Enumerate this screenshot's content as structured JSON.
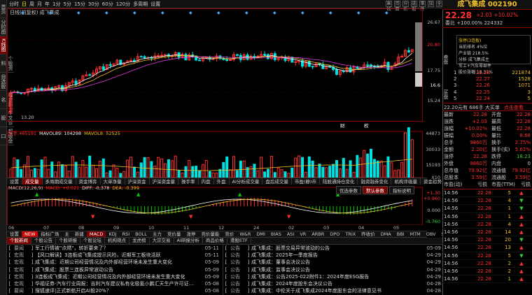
{
  "sidebar": {
    "items": [
      "首页",
      "分时图",
      "K线图",
      "个股资料",
      "自选股",
      "综合排名",
      "牛叉诊股",
      "超级盘口"
    ]
  },
  "toolbar": {
    "items": [
      "分时",
      "日",
      "周",
      "月",
      "年",
      "1分",
      "5分",
      "15分",
      "30分",
      "60分",
      "120分",
      "多周期",
      "设置"
    ],
    "selected": "日"
  },
  "toolbar_right": [
    "画线",
    "页面",
    "分析",
    "选股",
    "事件",
    "加",
    "全"
  ],
  "chart": {
    "title": "日线(前复权) 成飞集成",
    "price_axis": [
      "26.67",
      "20.80",
      "17.75",
      "16.6",
      "15.24"
    ],
    "low_label": "13.20",
    "high_box": "20.80",
    "last_box": "16.8",
    "ma_header": [
      {
        "t": "总手:465191",
        "c": "#ff3030"
      },
      {
        "t": "MAVOL89: 104298",
        "c": "#f0f0f0"
      },
      {
        "t": "MAVOL8: 52525",
        "c": "#f0c020"
      }
    ],
    "vol_axis": [
      "44873",
      "30033",
      "15193",
      "X10"
    ],
    "macd_header": [
      {
        "t": "MACD(12,26,9)",
        "c": "#ccc"
      },
      {
        "t": "MACD: +0.021",
        "c": "#ff3030"
      },
      {
        "t": "DIFF: -0.378",
        "c": "#f0f0f0"
      },
      {
        "t": "DEA: -0.399",
        "c": "#f0c020"
      }
    ],
    "macd_axis": [
      "+1.30",
      "+0.960",
      "0.000",
      "-0.760"
    ],
    "dates": [
      "06",
      "07",
      "08",
      "09",
      "10",
      "11",
      "12",
      "24",
      "02",
      "03",
      "04",
      "05"
    ],
    "event_tags": [
      "财",
      "权"
    ]
  },
  "tabs_mid": [
    "设置",
    "成交量",
    "多周期成交量",
    "资金博弈",
    "大单净量",
    "沪深资金",
    "沪深资金量",
    "操手率",
    "内盘",
    "外盘",
    "AI分析成交量",
    "盘后成交量",
    "市盈(静)市",
    "陆股通持仓变化",
    "融资融券变化",
    "机构评级量",
    "资金趋势"
  ],
  "tabs_mid_selected": "成交量",
  "macd_buttons": [
    "优选参数",
    "默认参数",
    "指标说明"
  ],
  "indicator_tabs": [
    "设置",
    "NEW",
    "指标广场",
    "主",
    "新建",
    "MACD",
    "KDJ",
    "RSI",
    "BOLL",
    "主力",
    "竞价量",
    "涨停",
    "竞价量能",
    "竞价",
    "W&R",
    "DMI",
    "BIAS",
    "ASI",
    "VR",
    "ARBR",
    "DPO",
    "TRIX",
    "昨收价",
    "DMA",
    "BBI",
    "MTM",
    "OBV",
    "SAR",
    "EXPMA"
  ],
  "indicator_selected": "MACD",
  "news_tabs": [
    "个股新闻",
    "个股公告",
    "个股研报",
    "个股论坛",
    "机构观点",
    "龙虎榜",
    "大宗交易",
    "AI研报分析",
    "商品价格",
    "港股ETF"
  ],
  "news_selected": "个股新闻",
  "news_left": [
    {
      "tag": "要闻",
      "title": "军工行情被\"点燃\"，转折要来了？",
      "date": "05-11"
    },
    {
      "tag": "宏观",
      "title": "【风口解读】3连板成飞集成提示风险，近期军工板块活跃",
      "date": "05-11"
    },
    {
      "tag": "宏观",
      "title": "成飞集成：近期公司经营情况及内外部经营环境未发生重大变化",
      "date": "05-09"
    },
    {
      "tag": "宏观",
      "title": "成飞集成：股票三连板异常波动公告",
      "date": "05-09"
    },
    {
      "tag": "宏观",
      "title": "3连板成飞集成：近期公司经营情况及内外部经营环境未发生重大变化",
      "date": "05-09"
    },
    {
      "tag": "宏观",
      "title": "华福证券-汽车行业周报：吉利汽车建议私有化极氪小鹏汇天生产许可证…",
      "date": "05-08"
    },
    {
      "tag": "要闻",
      "title": "搜狐速评|正式新航开启AI股20%？",
      "date": "05-08"
    }
  ],
  "news_right": [
    {
      "tag": "公告",
      "title": "成飞集成：股票交易异常波动的公告",
      "date": "05-09"
    },
    {
      "tag": "公告",
      "title": "成飞集成：2025年一季度报告",
      "date": "04-29"
    },
    {
      "tag": "公告",
      "title": "成飞集成：董事会决议公告",
      "date": "04-29"
    },
    {
      "tag": "公告",
      "title": "成飞集成：监事会决议公告",
      "date": "04-29"
    },
    {
      "tag": "公告",
      "title": "成飞集成：公告2025-022附件1：2024年度ESG报告",
      "date": "04-29"
    },
    {
      "tag": "公告",
      "title": "成飞集成：2024年度股东会决议公告",
      "date": "04-28"
    },
    {
      "tag": "公告",
      "title": "成飞集成：中伦关于成飞集成2024年度股东会的法律意见书",
      "date": "04-28"
    }
  ],
  "quote": {
    "title": "成飞集成 002190",
    "price": "22.28",
    "change": "+2.03 +10.02%",
    "weibi": "委比 +100.00% 224332",
    "bubble": [
      "涨停(3连板)",
      "当前排名 4%位",
      "产业链 218.5%",
      "分析 成飞集成主",
      "军工+汽车零部件",
      "股价涨幅 18.31%"
    ],
    "sell": [
      {
        "k": "5",
        "p": "",
        "v": ""
      },
      {
        "k": "4",
        "p": "",
        "v": ""
      },
      {
        "k": "3",
        "p": "",
        "v": ""
      },
      {
        "k": "2",
        "p": "",
        "v": ""
      },
      {
        "k": "1",
        "p": "",
        "v": ""
      }
    ],
    "buy": [
      {
        "k": "1",
        "p": "22.28",
        "v": "221874"
      },
      {
        "k": "2",
        "p": "22.27",
        "v": "1528"
      },
      {
        "k": "3",
        "p": "22.26",
        "v": "1071"
      },
      {
        "k": "4",
        "p": "22.25",
        "v": "3"
      },
      {
        "k": "5",
        "p": "22.24",
        "v": "5"
      }
    ],
    "buy_label": "买盘",
    "sell_label": "卖盘",
    "big_order": "22.20元有 686手 大买单",
    "view_btn": "点击查看",
    "stats": [
      [
        "最新",
        "22.28",
        "开盘",
        "22.28"
      ],
      [
        "涨跌",
        "+2.03",
        "最高",
        "22.28"
      ],
      [
        "涨幅",
        "+10.02%",
        "最低",
        "22.28"
      ],
      [
        "振幅",
        "0.00%",
        "量比",
        "8.68"
      ],
      [
        "总手",
        "9860万",
        "换手",
        "2.75%"
      ],
      [
        "金额",
        "2.20亿",
        "换手(实)",
        "5.62%"
      ],
      [
        "涨停",
        "22.28",
        "跌停",
        "18.23"
      ],
      [
        "外盘",
        "9860万",
        "内盘",
        "0"
      ],
      [
        "总市值",
        "79.92亿",
        "流通值",
        "79.92亿"
      ],
      [
        "总股本",
        "3.59亿",
        "流通股",
        "3.59亿"
      ],
      [
        "市盈(动)",
        "亏损",
        "市盈(TTM)",
        "亏损"
      ]
    ],
    "ticks": [
      {
        "t": "14:56",
        "p": "22.28",
        "v": "5",
        "d": "up"
      },
      {
        "t": "14:56",
        "p": "22.28",
        "v": "4",
        "d": "dn"
      },
      {
        "t": "14:56",
        "p": "22.28",
        "v": "1",
        "d": "dn"
      },
      {
        "t": "14:56",
        "p": "22.28",
        "v": "1",
        "d": "up"
      },
      {
        "t": "14:56",
        "p": "22.28",
        "v": "4",
        "d": "up"
      },
      {
        "t": "14:56",
        "p": "22.28",
        "v": "14",
        "d": "up"
      },
      {
        "t": "14:56",
        "p": "22.28",
        "v": "20",
        "d": "dn"
      },
      {
        "t": "14:56",
        "p": "22.28",
        "v": "13",
        "d": "up"
      },
      {
        "t": "14:56",
        "p": "22.28",
        "v": "5",
        "d": "dn"
      },
      {
        "t": "14:56",
        "p": "22.28",
        "v": "2",
        "d": "up"
      },
      {
        "t": "14:56",
        "p": "22.28",
        "v": "2",
        "d": "up"
      },
      {
        "t": "14:56",
        "p": "22.28",
        "v": "1",
        "d": "up"
      }
    ]
  }
}
